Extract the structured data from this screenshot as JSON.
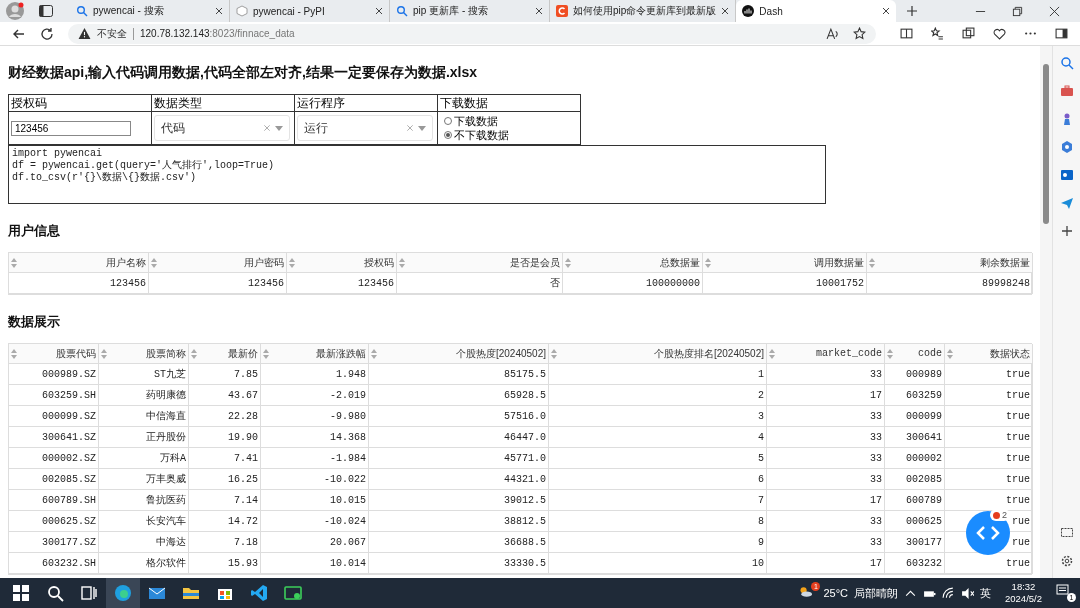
{
  "browser": {
    "tabs": [
      {
        "kind": "search",
        "title": "pywencai - 搜索",
        "selected": false
      },
      {
        "kind": "box",
        "title": "pywencai - PyPI",
        "selected": false
      },
      {
        "kind": "search",
        "title": "pip 更新库 - 搜索",
        "selected": false
      },
      {
        "kind": "c-logo",
        "title": "如何使用pip命令更新库到最新版",
        "selected": false
      },
      {
        "kind": "dash",
        "title": "Dash",
        "selected": true
      }
    ],
    "address": {
      "security": "不安全",
      "host": "120.78.132.143",
      "path": ":8023/finnace_data"
    }
  },
  "page": {
    "title": "财经数据api,输入代码调用数据,代码全部左对齐,结果一定要保存为数据.xlsx",
    "form": {
      "headers": [
        "授权码",
        "数据类型",
        "运行程序",
        "下载数据"
      ],
      "auth_code": "123456",
      "dropdowns": [
        {
          "value": "代码"
        },
        {
          "value": "运行"
        }
      ],
      "radios": [
        {
          "label": "下载数据",
          "selected": false
        },
        {
          "label": "不下载数据",
          "selected": true
        }
      ],
      "code": "import pywencai\ndf = pywencai.get(query='人气排行',loop=True)\ndf.to_csv(r'{}\\数据\\{}数据.csv')"
    },
    "user_info": {
      "heading": "用户信息",
      "columns": [
        "用户名称",
        "用户密码",
        "授权码",
        "是否是会员",
        "总数据量",
        "调用数据量",
        "剩余数据量"
      ],
      "rows": [
        [
          "123456",
          "123456",
          "123456",
          "否",
          "100000000",
          "10001752",
          "89998248"
        ]
      ]
    },
    "data": {
      "heading": "数据展示",
      "columns": [
        "股票代码",
        "股票简称",
        "最新价",
        "最新涨跌幅",
        "个股热度[20240502]",
        "个股热度排名[20240502]",
        "market_code",
        "code",
        "数据状态"
      ],
      "rows": [
        [
          "000989.SZ",
          "ST九芝",
          "7.85",
          "1.948",
          "85175.5",
          "1",
          "33",
          "000989",
          "true"
        ],
        [
          "603259.SH",
          "药明康德",
          "43.67",
          "-2.019",
          "65928.5",
          "2",
          "17",
          "603259",
          "true"
        ],
        [
          "000099.SZ",
          "中信海直",
          "22.28",
          "-9.980",
          "57516.0",
          "3",
          "33",
          "000099",
          "true"
        ],
        [
          "300641.SZ",
          "正丹股份",
          "19.90",
          "14.368",
          "46447.0",
          "4",
          "33",
          "300641",
          "true"
        ],
        [
          "000002.SZ",
          "万科A",
          "7.41",
          "-1.984",
          "45771.0",
          "5",
          "33",
          "000002",
          "true"
        ],
        [
          "002085.SZ",
          "万丰奥威",
          "16.25",
          "-10.022",
          "44321.0",
          "6",
          "33",
          "002085",
          "true"
        ],
        [
          "600789.SH",
          "鲁抗医药",
          "7.14",
          "10.015",
          "39012.5",
          "7",
          "17",
          "600789",
          "true"
        ],
        [
          "000625.SZ",
          "长安汽车",
          "14.72",
          "-10.024",
          "38812.5",
          "8",
          "33",
          "000625",
          "rue"
        ],
        [
          "300177.SZ",
          "中海达",
          "7.18",
          "20.067",
          "36688.5",
          "9",
          "33",
          "300177",
          "rue"
        ],
        [
          "603232.SH",
          "格尔软件",
          "15.93",
          "10.014",
          "33330.5",
          "10",
          "17",
          "603232",
          "true"
        ]
      ]
    },
    "debug_badge": "2"
  },
  "taskbar": {
    "weather_badge": "1",
    "temperature": "25°C",
    "weather": "局部晴朗",
    "ime": "英",
    "time": "18:32",
    "date": "2024/5/2",
    "notifications": "1"
  }
}
